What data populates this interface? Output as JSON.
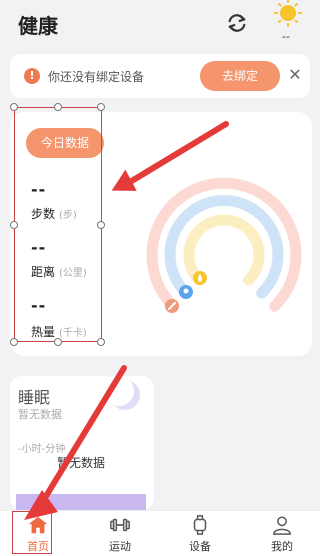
{
  "header": {
    "title": "健康",
    "weather_temp": "--"
  },
  "banner": {
    "message": "你还没有绑定设备",
    "bind_label": "去绑定",
    "close_glyph": "✕",
    "alert_glyph": "!"
  },
  "today": {
    "button_label": "今日数据",
    "stats": [
      {
        "value": "--",
        "label": "步数",
        "unit": "(步)"
      },
      {
        "value": "--",
        "label": "距离",
        "unit": "(公里)"
      },
      {
        "value": "--",
        "label": "热量",
        "unit": "(千卡)"
      }
    ]
  },
  "sleep": {
    "title": "睡眠",
    "subtitle": "暂无数据",
    "time_text": "-小时-分钟",
    "empty_text": "暂无数据"
  },
  "tabs": [
    {
      "label": "首页",
      "icon": "home-icon",
      "active": true
    },
    {
      "label": "运动",
      "icon": "dumbbell-icon",
      "active": false
    },
    {
      "label": "设备",
      "icon": "watch-icon",
      "active": false
    },
    {
      "label": "我的",
      "icon": "user-icon",
      "active": false
    }
  ],
  "colors": {
    "accent": "#f4956d",
    "ring_outer": "#fcd9d3",
    "ring_middle": "#cfe3f8",
    "ring_inner": "#fbeec0",
    "annotation": "#e53a3a",
    "active_tab": "#ee6b3f"
  }
}
